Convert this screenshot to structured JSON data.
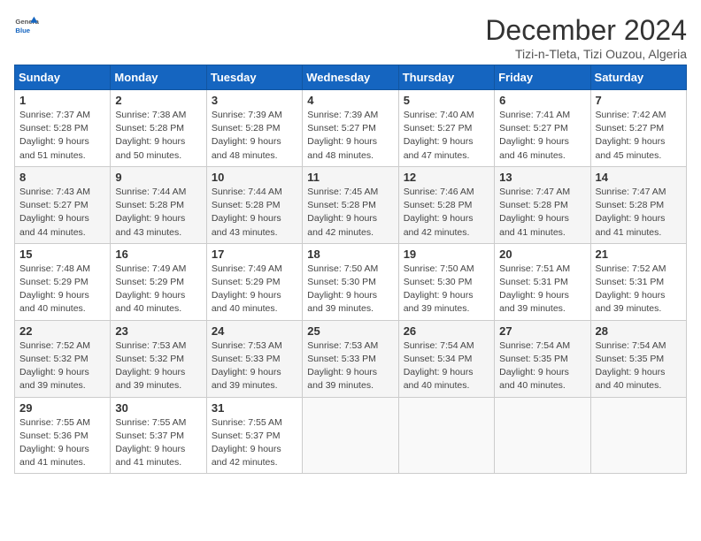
{
  "logo": {
    "general": "General",
    "blue": "Blue"
  },
  "title": "December 2024",
  "subtitle": "Tizi-n-Tleta, Tizi Ouzou, Algeria",
  "days_header": [
    "Sunday",
    "Monday",
    "Tuesday",
    "Wednesday",
    "Thursday",
    "Friday",
    "Saturday"
  ],
  "weeks": [
    [
      {
        "day": "1",
        "sunrise": "Sunrise: 7:37 AM",
        "sunset": "Sunset: 5:28 PM",
        "daylight": "Daylight: 9 hours and 51 minutes."
      },
      {
        "day": "2",
        "sunrise": "Sunrise: 7:38 AM",
        "sunset": "Sunset: 5:28 PM",
        "daylight": "Daylight: 9 hours and 50 minutes."
      },
      {
        "day": "3",
        "sunrise": "Sunrise: 7:39 AM",
        "sunset": "Sunset: 5:28 PM",
        "daylight": "Daylight: 9 hours and 48 minutes."
      },
      {
        "day": "4",
        "sunrise": "Sunrise: 7:39 AM",
        "sunset": "Sunset: 5:27 PM",
        "daylight": "Daylight: 9 hours and 48 minutes."
      },
      {
        "day": "5",
        "sunrise": "Sunrise: 7:40 AM",
        "sunset": "Sunset: 5:27 PM",
        "daylight": "Daylight: 9 hours and 47 minutes."
      },
      {
        "day": "6",
        "sunrise": "Sunrise: 7:41 AM",
        "sunset": "Sunset: 5:27 PM",
        "daylight": "Daylight: 9 hours and 46 minutes."
      },
      {
        "day": "7",
        "sunrise": "Sunrise: 7:42 AM",
        "sunset": "Sunset: 5:27 PM",
        "daylight": "Daylight: 9 hours and 45 minutes."
      }
    ],
    [
      {
        "day": "8",
        "sunrise": "Sunrise: 7:43 AM",
        "sunset": "Sunset: 5:27 PM",
        "daylight": "Daylight: 9 hours and 44 minutes."
      },
      {
        "day": "9",
        "sunrise": "Sunrise: 7:44 AM",
        "sunset": "Sunset: 5:28 PM",
        "daylight": "Daylight: 9 hours and 43 minutes."
      },
      {
        "day": "10",
        "sunrise": "Sunrise: 7:44 AM",
        "sunset": "Sunset: 5:28 PM",
        "daylight": "Daylight: 9 hours and 43 minutes."
      },
      {
        "day": "11",
        "sunrise": "Sunrise: 7:45 AM",
        "sunset": "Sunset: 5:28 PM",
        "daylight": "Daylight: 9 hours and 42 minutes."
      },
      {
        "day": "12",
        "sunrise": "Sunrise: 7:46 AM",
        "sunset": "Sunset: 5:28 PM",
        "daylight": "Daylight: 9 hours and 42 minutes."
      },
      {
        "day": "13",
        "sunrise": "Sunrise: 7:47 AM",
        "sunset": "Sunset: 5:28 PM",
        "daylight": "Daylight: 9 hours and 41 minutes."
      },
      {
        "day": "14",
        "sunrise": "Sunrise: 7:47 AM",
        "sunset": "Sunset: 5:28 PM",
        "daylight": "Daylight: 9 hours and 41 minutes."
      }
    ],
    [
      {
        "day": "15",
        "sunrise": "Sunrise: 7:48 AM",
        "sunset": "Sunset: 5:29 PM",
        "daylight": "Daylight: 9 hours and 40 minutes."
      },
      {
        "day": "16",
        "sunrise": "Sunrise: 7:49 AM",
        "sunset": "Sunset: 5:29 PM",
        "daylight": "Daylight: 9 hours and 40 minutes."
      },
      {
        "day": "17",
        "sunrise": "Sunrise: 7:49 AM",
        "sunset": "Sunset: 5:29 PM",
        "daylight": "Daylight: 9 hours and 40 minutes."
      },
      {
        "day": "18",
        "sunrise": "Sunrise: 7:50 AM",
        "sunset": "Sunset: 5:30 PM",
        "daylight": "Daylight: 9 hours and 39 minutes."
      },
      {
        "day": "19",
        "sunrise": "Sunrise: 7:50 AM",
        "sunset": "Sunset: 5:30 PM",
        "daylight": "Daylight: 9 hours and 39 minutes."
      },
      {
        "day": "20",
        "sunrise": "Sunrise: 7:51 AM",
        "sunset": "Sunset: 5:31 PM",
        "daylight": "Daylight: 9 hours and 39 minutes."
      },
      {
        "day": "21",
        "sunrise": "Sunrise: 7:52 AM",
        "sunset": "Sunset: 5:31 PM",
        "daylight": "Daylight: 9 hours and 39 minutes."
      }
    ],
    [
      {
        "day": "22",
        "sunrise": "Sunrise: 7:52 AM",
        "sunset": "Sunset: 5:32 PM",
        "daylight": "Daylight: 9 hours and 39 minutes."
      },
      {
        "day": "23",
        "sunrise": "Sunrise: 7:53 AM",
        "sunset": "Sunset: 5:32 PM",
        "daylight": "Daylight: 9 hours and 39 minutes."
      },
      {
        "day": "24",
        "sunrise": "Sunrise: 7:53 AM",
        "sunset": "Sunset: 5:33 PM",
        "daylight": "Daylight: 9 hours and 39 minutes."
      },
      {
        "day": "25",
        "sunrise": "Sunrise: 7:53 AM",
        "sunset": "Sunset: 5:33 PM",
        "daylight": "Daylight: 9 hours and 39 minutes."
      },
      {
        "day": "26",
        "sunrise": "Sunrise: 7:54 AM",
        "sunset": "Sunset: 5:34 PM",
        "daylight": "Daylight: 9 hours and 40 minutes."
      },
      {
        "day": "27",
        "sunrise": "Sunrise: 7:54 AM",
        "sunset": "Sunset: 5:35 PM",
        "daylight": "Daylight: 9 hours and 40 minutes."
      },
      {
        "day": "28",
        "sunrise": "Sunrise: 7:54 AM",
        "sunset": "Sunset: 5:35 PM",
        "daylight": "Daylight: 9 hours and 40 minutes."
      }
    ],
    [
      {
        "day": "29",
        "sunrise": "Sunrise: 7:55 AM",
        "sunset": "Sunset: 5:36 PM",
        "daylight": "Daylight: 9 hours and 41 minutes."
      },
      {
        "day": "30",
        "sunrise": "Sunrise: 7:55 AM",
        "sunset": "Sunset: 5:37 PM",
        "daylight": "Daylight: 9 hours and 41 minutes."
      },
      {
        "day": "31",
        "sunrise": "Sunrise: 7:55 AM",
        "sunset": "Sunset: 5:37 PM",
        "daylight": "Daylight: 9 hours and 42 minutes."
      },
      null,
      null,
      null,
      null
    ]
  ]
}
